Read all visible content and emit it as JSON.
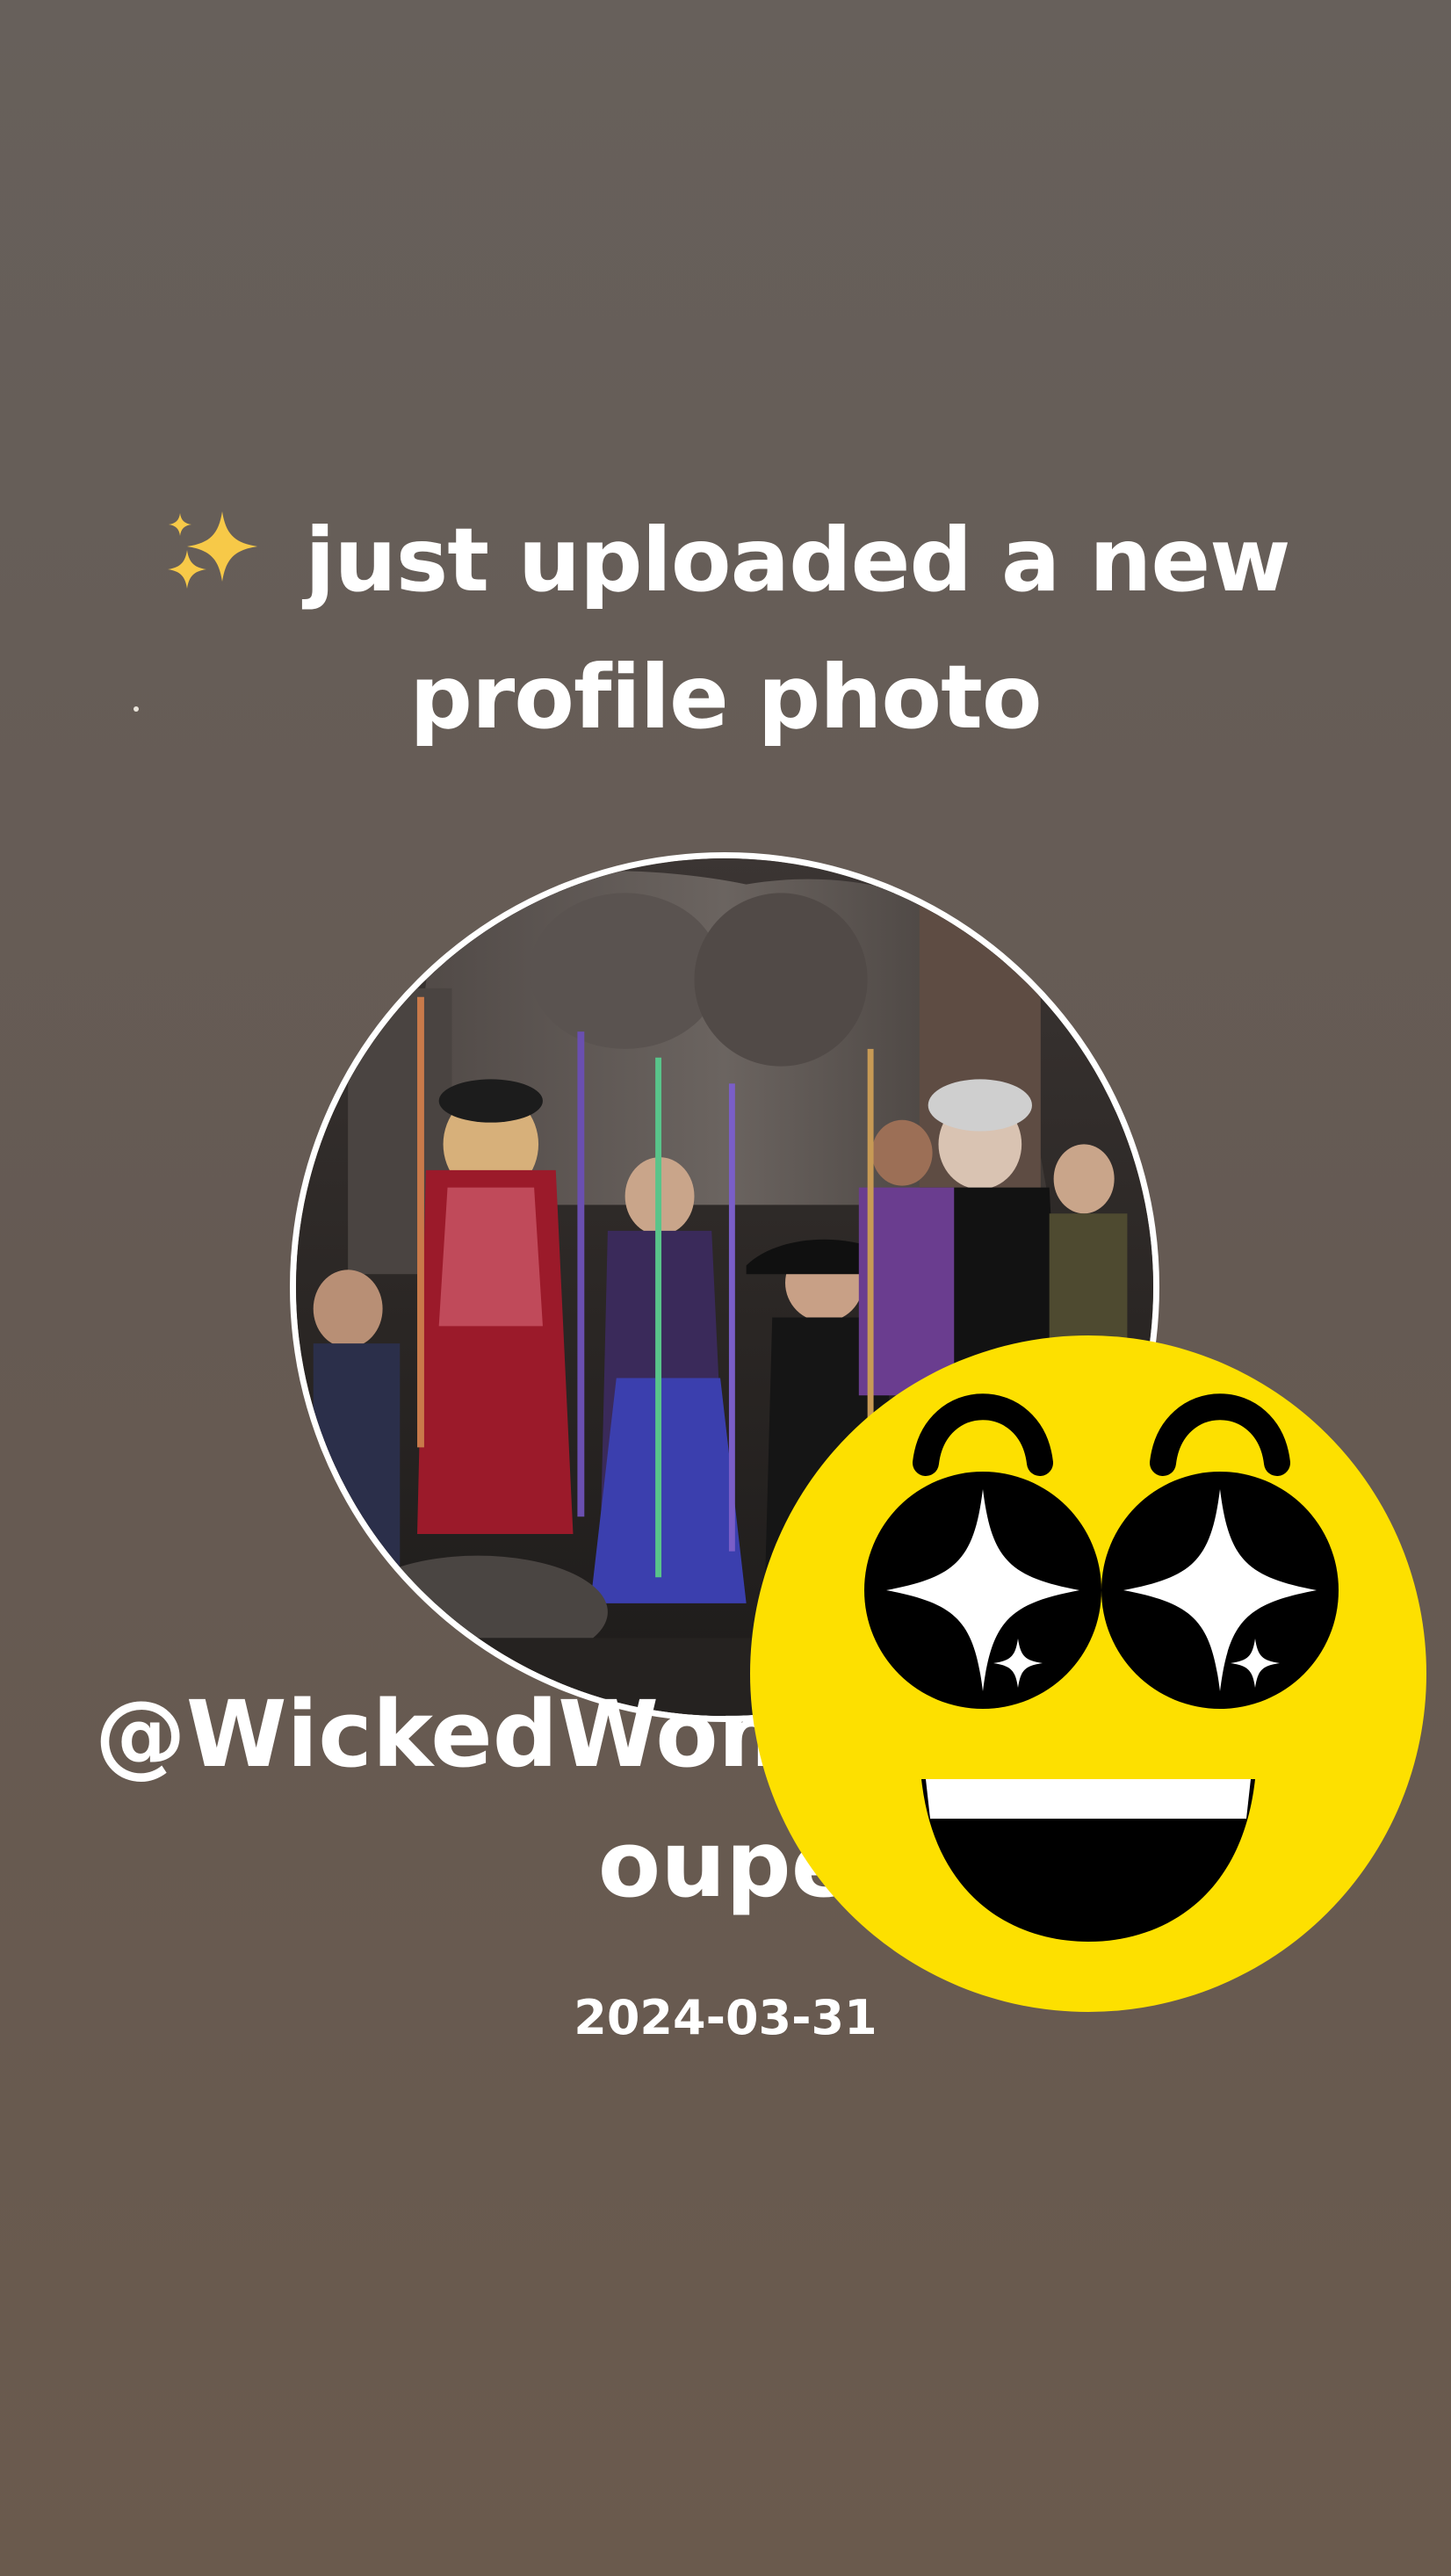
{
  "post": {
    "headline": "✨I just uploaded a new profile photo",
    "headline_icon": "sparkles-icon",
    "handle": "@WickedWomenDanceTroupe",
    "date": "2024-03-31"
  },
  "avatar": {
    "description_icon": "group-photo"
  },
  "sticker": {
    "icon": "star-struck-emoji"
  },
  "colors": {
    "background_top": "#67605b",
    "background_bottom": "#6a5a4d",
    "emoji_yellow": "#fde000",
    "text": "#ffffff"
  }
}
